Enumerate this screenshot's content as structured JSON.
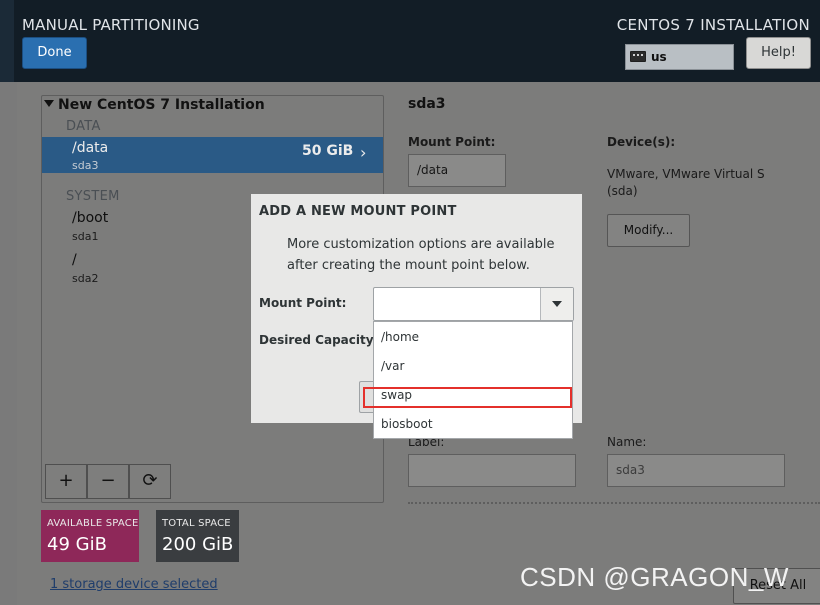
{
  "header": {
    "title": "MANUAL PARTITIONING",
    "product": "CENTOS 7 INSTALLATION",
    "done_label": "Done",
    "keyboard_layout": "us",
    "help_label": "Help!"
  },
  "tree": {
    "install_title": "New CentOS 7 Installation",
    "sections": [
      {
        "label": "DATA"
      },
      {
        "label": "SYSTEM"
      }
    ],
    "items": [
      {
        "mount": "/data",
        "device": "sda3",
        "size": "50 GiB",
        "selected": true
      },
      {
        "mount": "/boot",
        "device": "sda1"
      },
      {
        "mount": "/",
        "device": "sda2"
      }
    ],
    "toolbar": {
      "add": "+",
      "remove": "−",
      "refresh": "⟳"
    }
  },
  "space": {
    "available_label": "AVAILABLE SPACE",
    "available_value": "49 GiB",
    "total_label": "TOTAL SPACE",
    "total_value": "200 GiB"
  },
  "storage_link": "1 storage device selected",
  "detail": {
    "title": "sda3",
    "mount_point_label": "Mount Point:",
    "mount_point_value": "/data",
    "devices_label": "Device(s):",
    "device_line1": "VMware, VMware Virtual S",
    "device_line2": "(sda)",
    "modify_label": "Modify...",
    "label_label": "Label:",
    "name_label": "Name:",
    "name_value": "sda3",
    "reset_label": "Reset All"
  },
  "modal": {
    "title": "ADD A NEW MOUNT POINT",
    "description": "More customization options are available after creating the mount point below.",
    "mount_point_label": "Mount Point:",
    "capacity_label": "Desired Capacity:",
    "mount_point_value": "",
    "options": [
      "/home",
      "/var",
      "swap",
      "biosboot"
    ],
    "highlighted_option": "swap"
  },
  "watermark": "CSDN @GRAGON_W",
  "colors": {
    "header_bg": "#121d26",
    "selected_row": "#2a5a86",
    "available_space": "#8e2859",
    "total_space": "#3a3d40",
    "highlight_box": "#e4302b"
  }
}
